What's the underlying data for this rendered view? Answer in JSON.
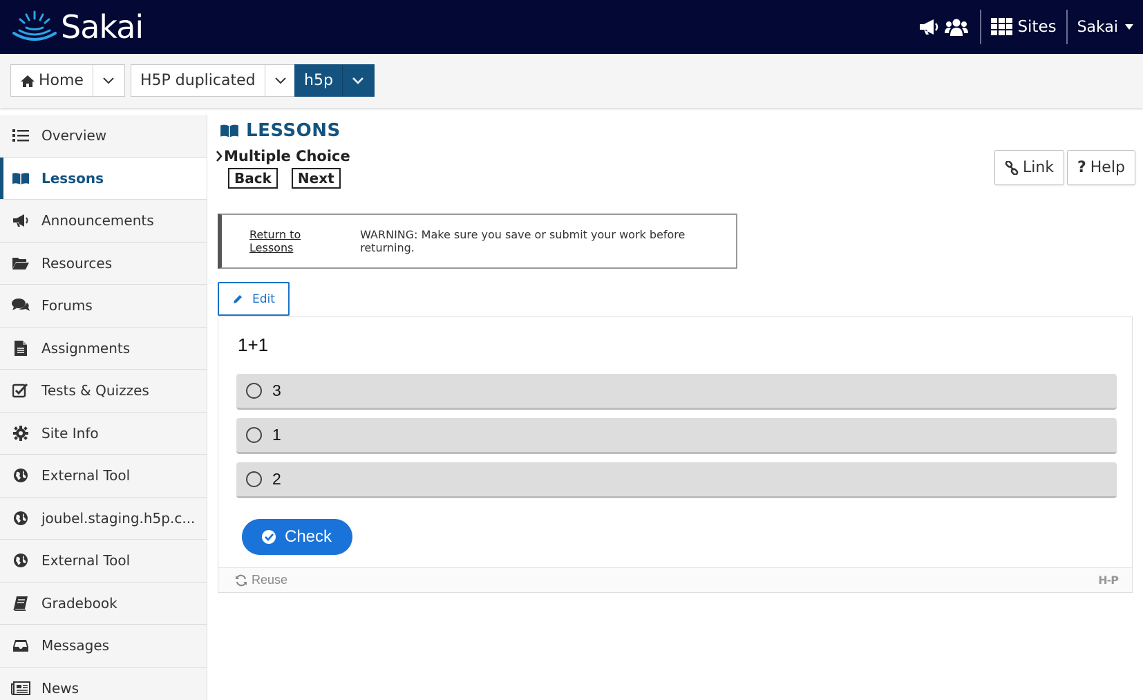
{
  "header": {
    "logo_text": "Sakai",
    "sites_label": "Sites",
    "user_label": "Sakai",
    "icons": [
      "megaphone-icon",
      "people-icon",
      "grid-icon",
      "caret-down-icon"
    ]
  },
  "sitenav": {
    "items": [
      {
        "label": "Home",
        "icon": "home-icon"
      },
      {
        "label": "H5P duplicated"
      },
      {
        "label": "h5p",
        "active": true
      }
    ]
  },
  "sidebar": {
    "items": [
      {
        "label": "Overview",
        "icon": "list-icon"
      },
      {
        "label": "Lessons",
        "icon": "book-icon",
        "active": true
      },
      {
        "label": "Announcements",
        "icon": "megaphone-icon"
      },
      {
        "label": "Resources",
        "icon": "folder-icon"
      },
      {
        "label": "Forums",
        "icon": "comments-icon"
      },
      {
        "label": "Assignments",
        "icon": "file-icon"
      },
      {
        "label": "Tests & Quizzes",
        "icon": "checkbox-icon"
      },
      {
        "label": "Site Info",
        "icon": "gear-icon"
      },
      {
        "label": "External Tool",
        "icon": "globe-icon"
      },
      {
        "label": "joubel.staging.h5p.c...",
        "icon": "globe-icon"
      },
      {
        "label": "External Tool",
        "icon": "globe-icon"
      },
      {
        "label": "Gradebook",
        "icon": "gradebook-icon"
      },
      {
        "label": "Messages",
        "icon": "inbox-icon"
      },
      {
        "label": "News",
        "icon": "newspaper-icon"
      }
    ]
  },
  "main": {
    "title": "LESSONS",
    "breadcrumb": "Multiple Choice",
    "back_label": "Back",
    "next_label": "Next",
    "link_label": "Link",
    "help_label": "Help",
    "return_link": "Return to Lessons",
    "warning": "WARNING: Make sure you save or submit your work before returning.",
    "edit_label": "Edit"
  },
  "h5p": {
    "question": "1+1",
    "answers": [
      "3",
      "1",
      "2"
    ],
    "check_label": "Check",
    "reuse_label": "Reuse",
    "logo": "H-P"
  },
  "colors": {
    "topbar": "#040834",
    "accent": "#145380",
    "h5p_blue": "#1a73d9"
  }
}
